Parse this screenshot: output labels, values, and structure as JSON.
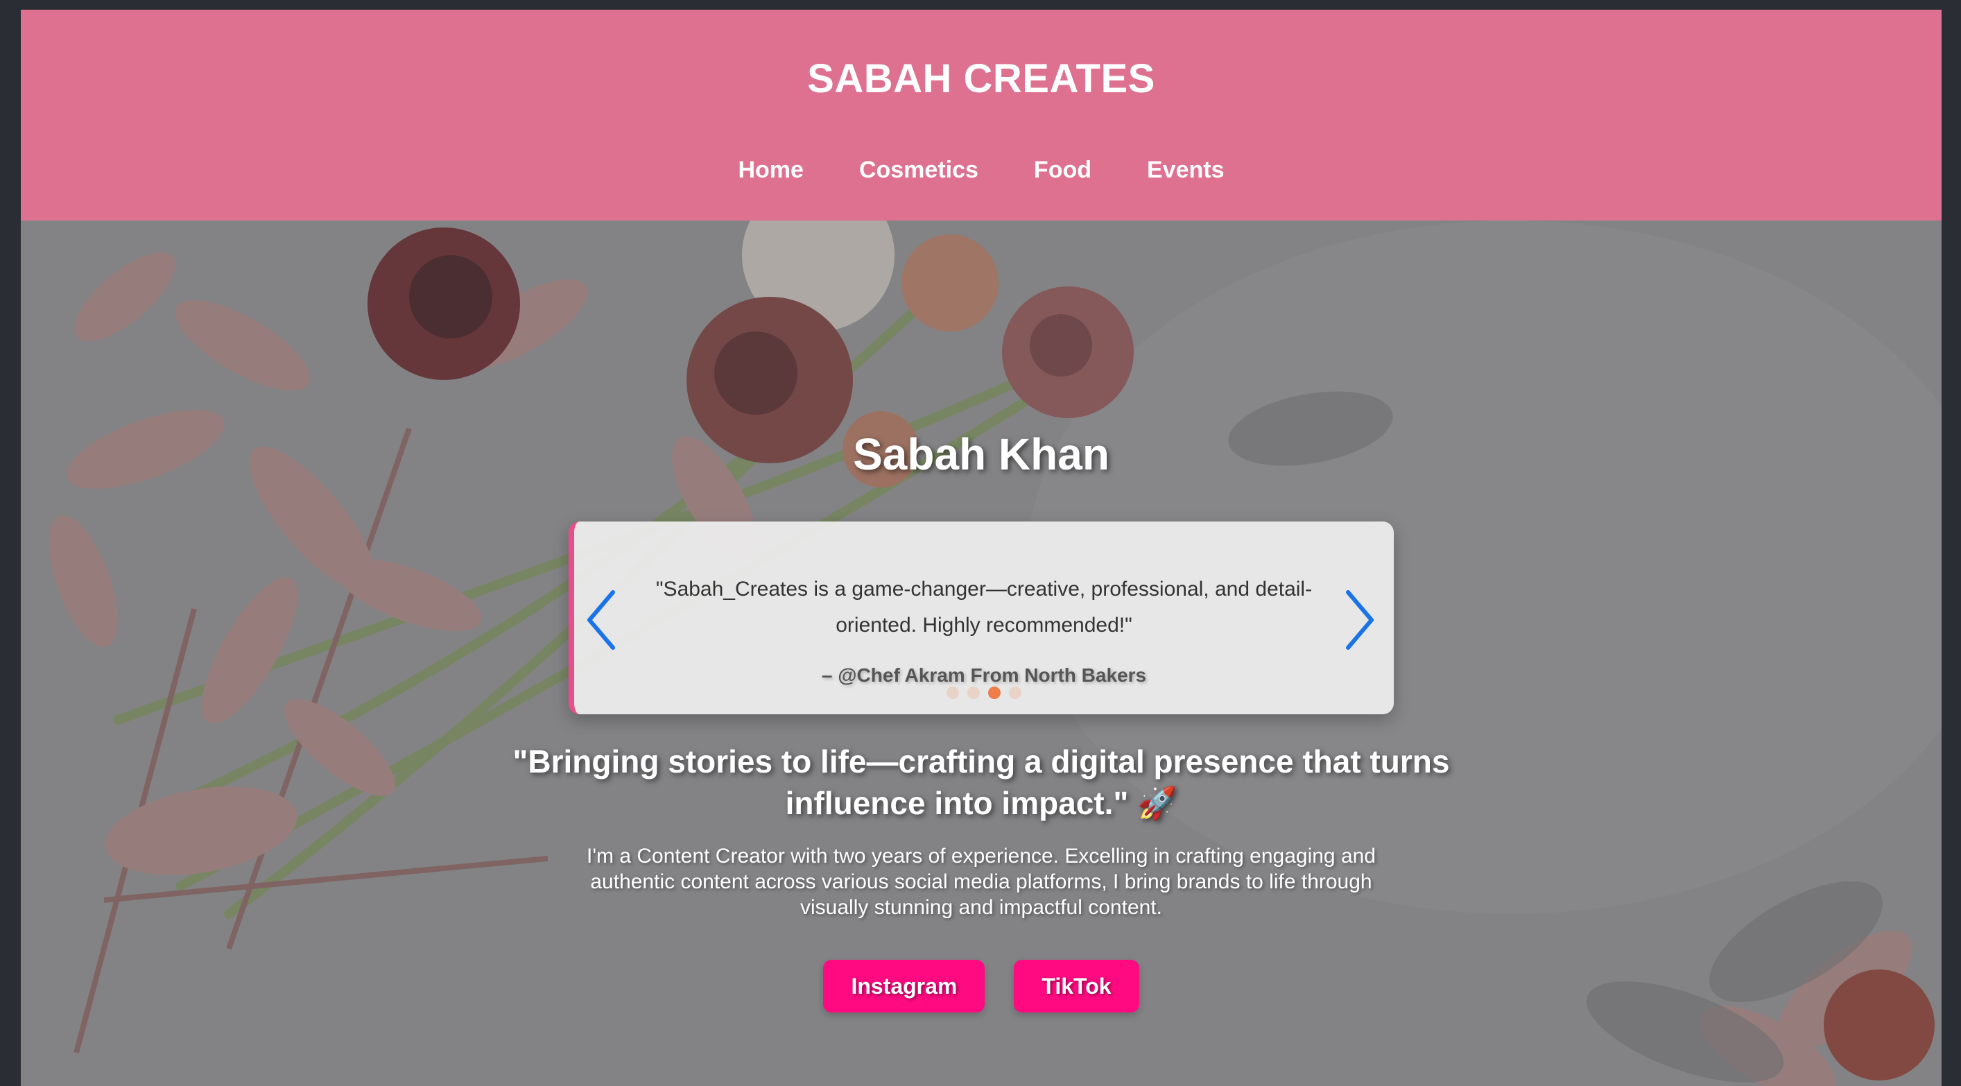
{
  "header": {
    "title": "SABAH CREATES",
    "nav": [
      {
        "label": "Home"
      },
      {
        "label": "Cosmetics"
      },
      {
        "label": "Food"
      },
      {
        "label": "Events"
      }
    ]
  },
  "hero": {
    "name": "Sabah Khan",
    "testimonial": {
      "quote": "\"Sabah_Creates is a game-changer—creative, professional, and detail-oriented. Highly recommended!\"",
      "author": "– @Chef Akram From North Bakers",
      "slide_count": 4,
      "active_slide": 3
    },
    "tagline": "\"Bringing stories to life—crafting a digital presence that turns influence into impact.\" 🚀",
    "bio": "I'm a Content Creator with two years of experience. Excelling in crafting engaging and authentic content across various social media platforms, I bring brands to life through visually stunning and impactful content.",
    "buttons": {
      "instagram": "Instagram",
      "tiktok": "TikTok"
    }
  },
  "colors": {
    "header_bg": "#de7090",
    "button_bg": "#ff0a80",
    "arrow": "#1a73e8",
    "card_accent": "#e94d8c",
    "active_dot": "#ee7d4a"
  },
  "icons": {
    "prev": "chevron-left-icon",
    "next": "chevron-right-icon"
  }
}
